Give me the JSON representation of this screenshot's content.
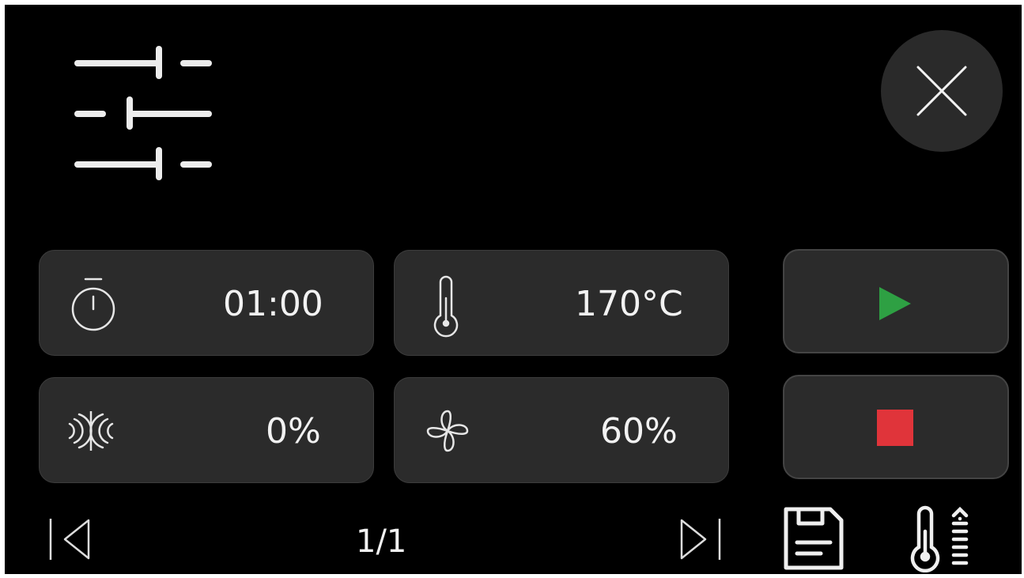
{
  "header": {
    "settings_icon": "sliders-icon",
    "close_icon": "close-icon"
  },
  "parameters": {
    "time": {
      "icon": "stopwatch-icon",
      "value": "01:00"
    },
    "temperature": {
      "icon": "thermometer-icon",
      "value": "170°C"
    },
    "humidity": {
      "icon": "humidity-icon",
      "value": "0%"
    },
    "fan": {
      "icon": "fan-icon",
      "value": "60%"
    }
  },
  "actions": {
    "start_icon": "play-icon",
    "stop_icon": "stop-icon"
  },
  "footer": {
    "page_indicator": "1/1",
    "prev_icon": "previous-page-icon",
    "next_icon": "next-page-icon",
    "save_icon": "save-icon",
    "core_temp_icon": "core-temperature-icon"
  },
  "colors": {
    "background": "#000000",
    "tile": "#2b2b2b",
    "play": "#2ea043",
    "stop": "#e0343a",
    "text": "#f2f2f2"
  }
}
